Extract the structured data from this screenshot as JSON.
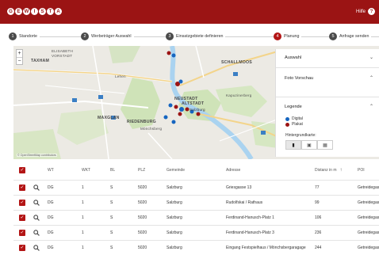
{
  "header": {
    "logo_letters": [
      "G",
      "E",
      "W",
      "I",
      "S",
      "T",
      "A"
    ],
    "help_label": "Hilfe",
    "help_icon": "question-circle-icon"
  },
  "stepper": {
    "steps": [
      {
        "num": "1",
        "label": "Standorte",
        "active": false
      },
      {
        "num": "2",
        "label": "Werbeträger Auswahl",
        "active": false
      },
      {
        "num": "3",
        "label": "Einsatzgebiete definieren",
        "active": false
      },
      {
        "num": "4",
        "label": "Planung",
        "active": true
      },
      {
        "num": "5",
        "label": "Anfrage senden",
        "active": false
      }
    ]
  },
  "map": {
    "labels": {
      "elisabeth": "ELISABETH",
      "vorstadt": "VORSTADT",
      "taxham": "TAXHAM",
      "schallmoos": "SCHALLMOOS",
      "neustadt": "NEUSTADT",
      "altstadt": "ALTSTADT",
      "maxglan": "MAXGLAN",
      "riedenburg": "RIEDENBURG",
      "kapuzinerberg": "Kapuzinerberg",
      "salzburg": "Salzburg",
      "moenchsberg": "Mönchsberg",
      "lehen": "Lehen"
    },
    "attribution": "© OpenStreetMap contributors"
  },
  "panel": {
    "selection_title": "Auswahl",
    "photo_title": "Foto Vorschau",
    "legend_title": "Legende",
    "legend_items": [
      {
        "label": "Digital",
        "color": "#1565c0"
      },
      {
        "label": "Plakat",
        "color": "#9b1414"
      }
    ],
    "basemap_label": "Hintergrundkarte:"
  },
  "table": {
    "headers": [
      "WT",
      "WKT",
      "BL",
      "PLZ",
      "Gemeinde",
      "Adresse",
      "Distanz in m",
      "POI"
    ],
    "rows": [
      {
        "wt": "DG",
        "wkt": "1",
        "bl": "S",
        "plz": "5020",
        "gemeinde": "Salzburg",
        "adresse": "Griesgasse 13",
        "distanz": "77",
        "poi": "Getreidegasse"
      },
      {
        "wt": "DG",
        "wkt": "1",
        "bl": "S",
        "plz": "5020",
        "gemeinde": "Salzburg",
        "adresse": "Rudolfskai / Rathaus",
        "distanz": "99",
        "poi": "Getreidegasse"
      },
      {
        "wt": "DG",
        "wkt": "1",
        "bl": "S",
        "plz": "5020",
        "gemeinde": "Salzburg",
        "adresse": "Ferdinand-Hanusch-Platz 1",
        "distanz": "106",
        "poi": "Getreidegasse"
      },
      {
        "wt": "DG",
        "wkt": "1",
        "bl": "S",
        "plz": "5020",
        "gemeinde": "Salzburg",
        "adresse": "Ferdinand-Hanusch-Platz 3",
        "distanz": "236",
        "poi": "Getreidegasse"
      },
      {
        "wt": "DG",
        "wkt": "1",
        "bl": "S",
        "plz": "5020",
        "gemeinde": "Salzburg",
        "adresse": "Eingang Festspielhaus / Mönchsbergaragage",
        "distanz": "244",
        "poi": "Getreidegasse"
      }
    ]
  },
  "colors": {
    "brand": "#9b1414",
    "checkbox": "#b31515",
    "digital": "#1565c0",
    "plakat": "#9b1414"
  }
}
